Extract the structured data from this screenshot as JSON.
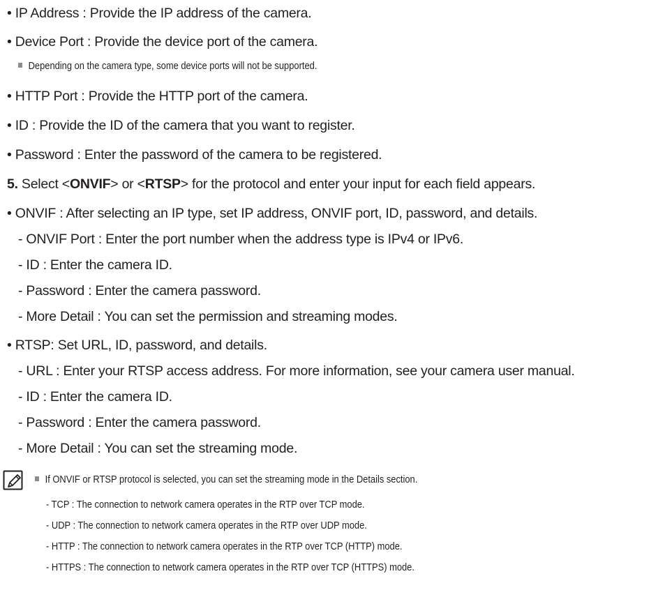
{
  "bullets_top": [
    {
      "prefix": "•",
      "text": " IP Address : Provide the IP address of the camera."
    },
    {
      "prefix": "•",
      "text": " Device Port : Provide the device port of the camera."
    }
  ],
  "device_note": "Depending on the camera type, some device ports will not be supported.",
  "bullets_mid": [
    {
      "prefix": "•",
      "text": " HTTP Port : Provide the HTTP port of the camera."
    },
    {
      "prefix": "•",
      "text": " ID : Provide the ID of the camera that you want to register."
    },
    {
      "prefix": "•",
      "text": " Password : Enter the password of the camera to be registered."
    }
  ],
  "step5": {
    "number": "5.",
    "t1": " Select <",
    "onvif": "ONVIF",
    "t2": "> or <",
    "rtsp": "RTSP",
    "t3": "> for the protocol and enter your input for each field appears."
  },
  "onvif": {
    "head": "• ONVIF : After selecting an IP type, set IP address, ONVIF port, ID, password, and details.",
    "items": [
      "- ONVIF Port : Enter the port number when the address type is IPv4 or IPv6.",
      "- ID : Enter the camera ID.",
      "- Password : Enter the camera password.",
      "- More Detail : You can set the permission and streaming modes."
    ]
  },
  "rtsp": {
    "head": "• RTSP: Set URL, ID, password, and details.",
    "items": [
      "- URL : Enter your RTSP access address. For more information, see your camera user manual.",
      "- ID : Enter the camera ID.",
      "- Password : Enter the camera password.",
      "- More Detail : You can set the streaming mode."
    ]
  },
  "note_box": {
    "icon": "note-pencil-icon",
    "main": "If ONVIF or RTSP protocol is selected, you can set the streaming mode in the Details section.",
    "items": [
      "-   TCP : The connection to network camera operates in the RTP over TCP mode.",
      "-   UDP : The connection to network camera operates in the RTP over UDP mode.",
      "-   HTTP : The connection to network camera operates in the RTP over TCP (HTTP) mode.",
      "-   HTTPS : The connection to network camera operates in the RTP over TCP (HTTPS) mode."
    ]
  }
}
